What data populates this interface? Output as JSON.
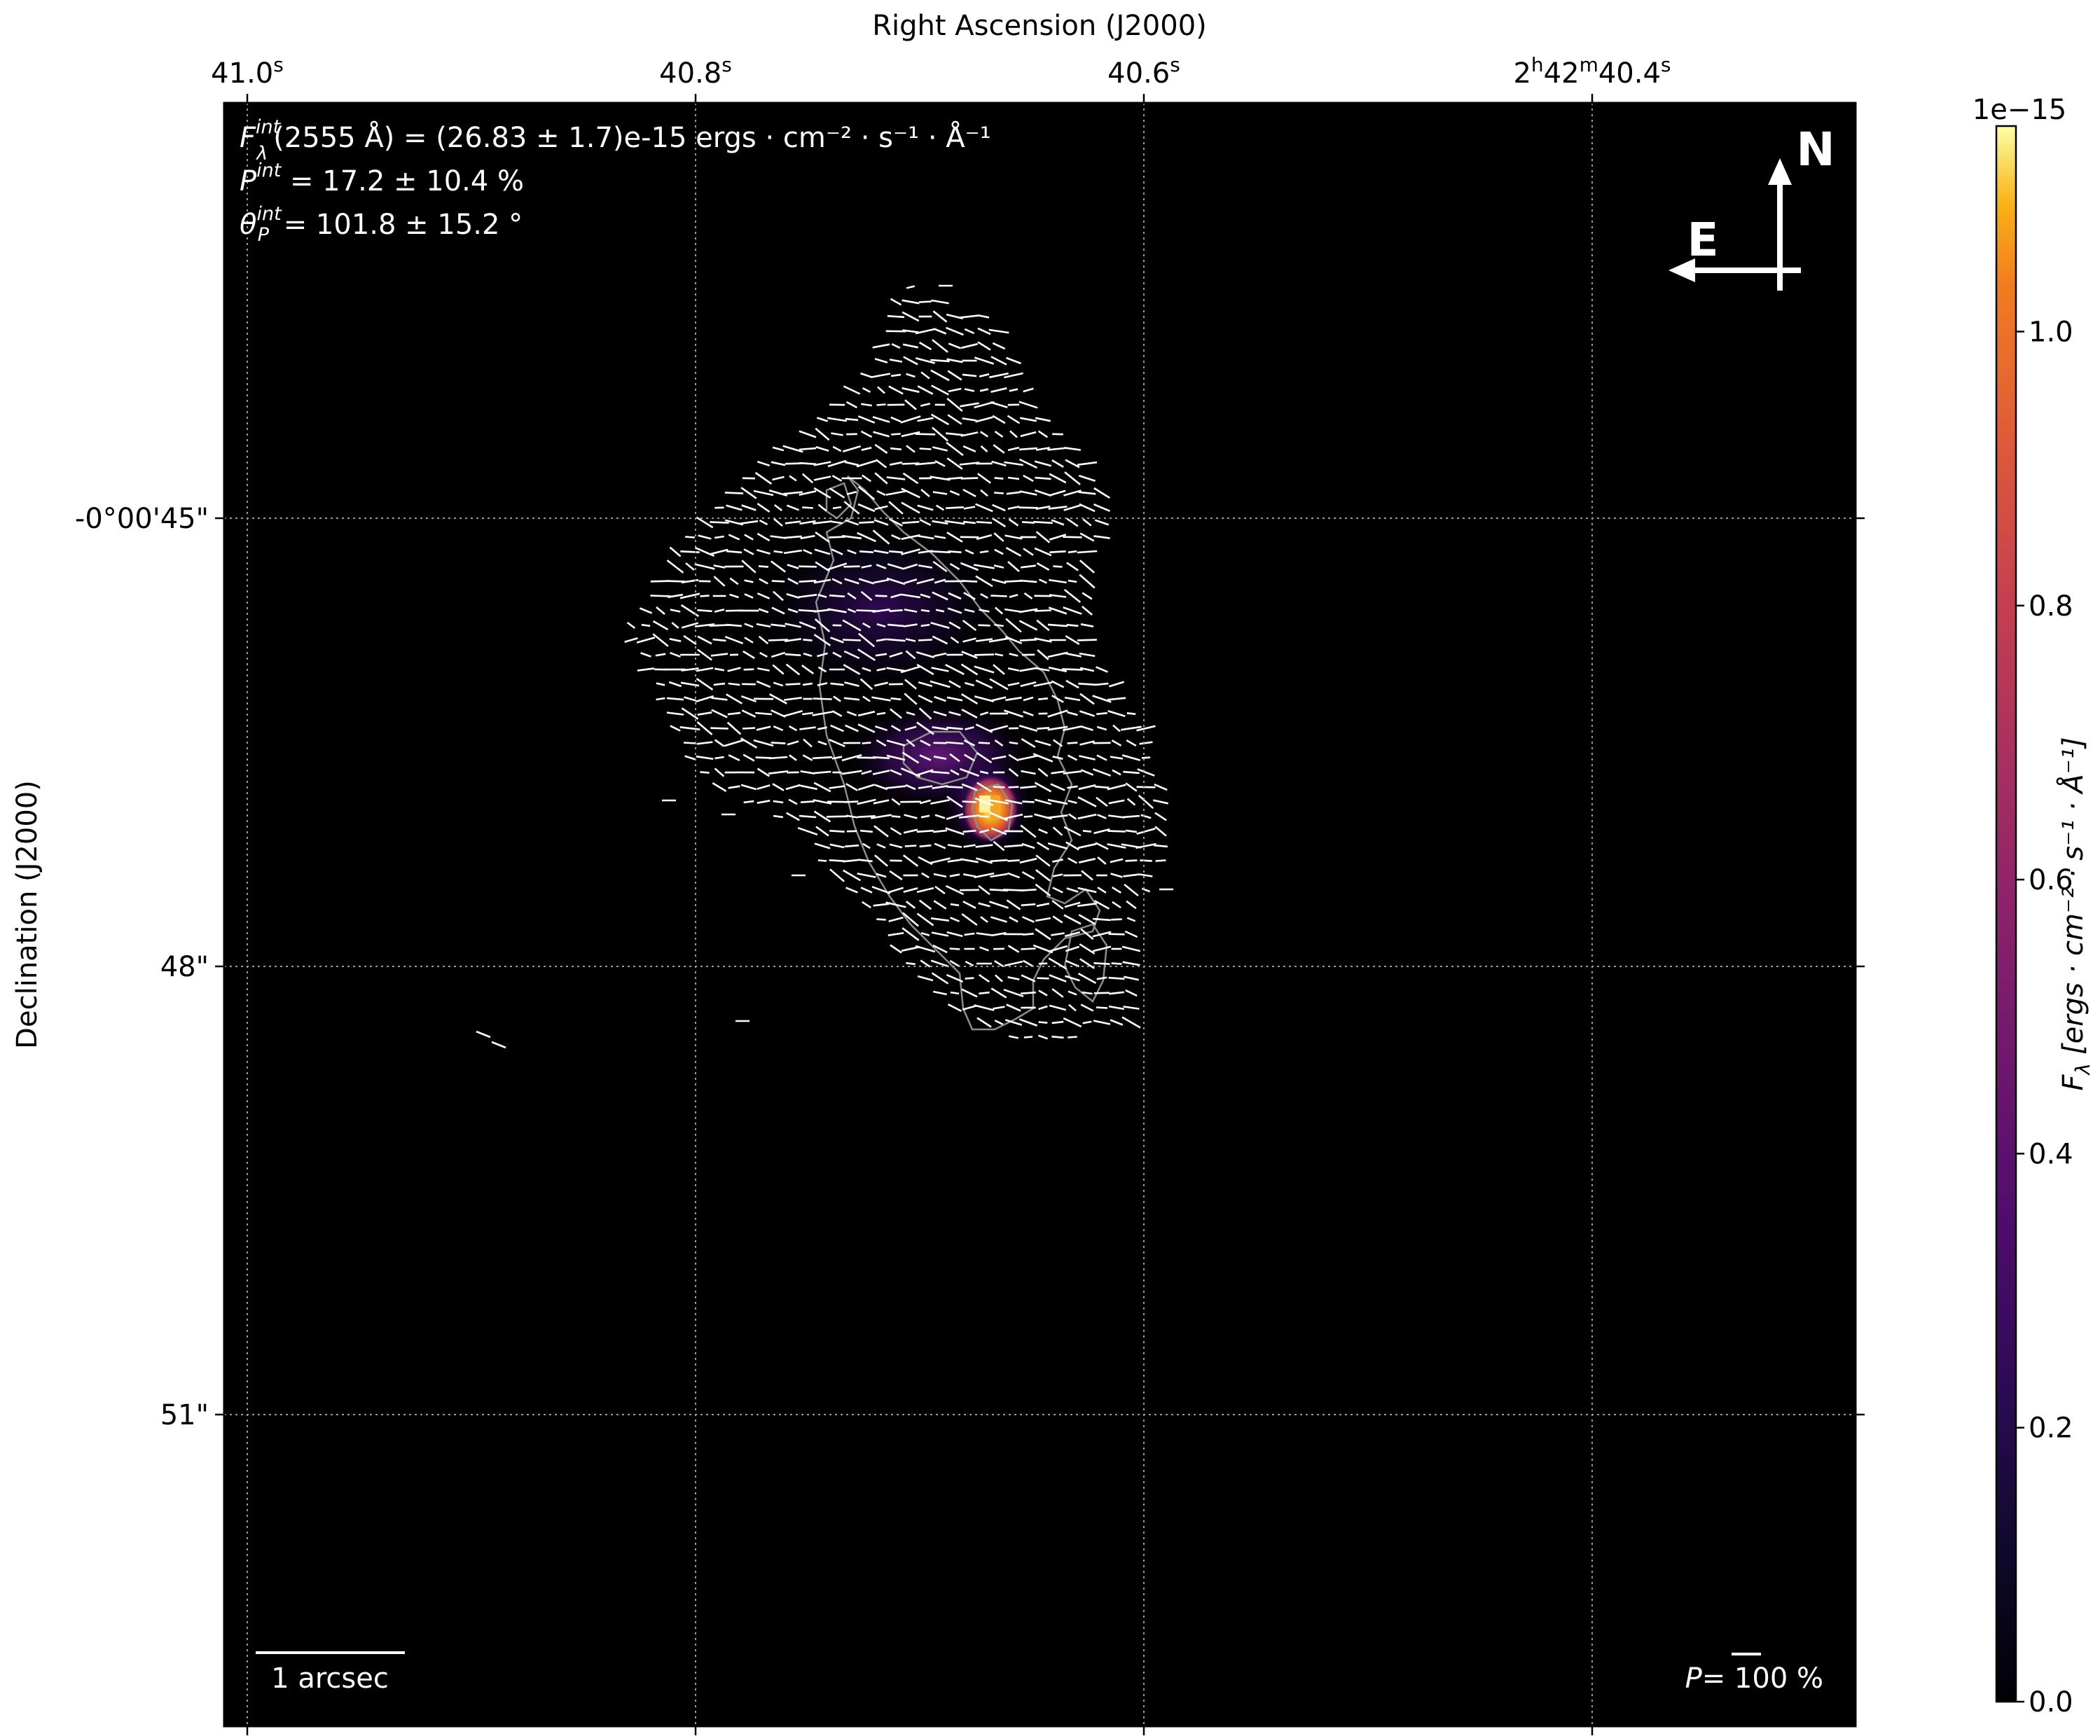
{
  "chart_data": {
    "type": "heatmap",
    "title": "",
    "xlabel": "Right Ascension (J2000)",
    "ylabel": "Declination (J2000)",
    "x_ticks": [
      {
        "main": "41.0",
        "sup": "s"
      },
      {
        "main": "40.8",
        "sup": "s"
      },
      {
        "main": "40.6",
        "sup": "s"
      },
      {
        "main": "2",
        "sup": "h",
        "main2": "42",
        "sup2": "m",
        "main3": "40.4",
        "sup3": "s"
      }
    ],
    "y_ticks": [
      "-0°00'45\"",
      "48\"",
      "51\""
    ],
    "grid": true,
    "colormap": "inferno",
    "colorbar": {
      "label": "F_λ [ergs · cm⁻² · s⁻¹ · Å⁻¹]",
      "label_main": "F",
      "label_sub": "λ",
      "label_rest": "[ergs · cm⁻² · s⁻¹ · Å⁻¹]",
      "scale_label": "1e−15",
      "ticks": [
        "0.0",
        "0.2",
        "0.4",
        "0.6",
        "0.8",
        "1.0"
      ],
      "range": [
        0.0,
        1.15
      ]
    },
    "integrated": {
      "flux_line": "F_λ^int(2555 Å) = (26.83 ± 1.7)e-15 ergs · cm⁻² · s⁻¹ · Å⁻¹",
      "flux_parts": {
        "sym": "F",
        "sub": "λ",
        "sup": "int",
        "text": "(2555 Å) = (26.83 ± 1.7)e-15 ergs · cm⁻² · s⁻¹ · Å⁻¹"
      },
      "pol_parts": {
        "sym": "P",
        "sup": "int",
        "text": " = 17.2 ± 10.4 %"
      },
      "angle_parts": {
        "sym": "θ",
        "sub": "P",
        "sup": "int",
        "text": " = 101.8 ± 15.2 °"
      },
      "flux_value_e15": 26.83,
      "flux_error_e15": 1.7,
      "P_int_percent": 17.2,
      "P_int_error_percent": 10.4,
      "theta_P_int_deg": 101.8,
      "theta_P_int_error_deg": 15.2
    },
    "compass": {
      "north": "N",
      "east": "E"
    },
    "scalebar_label": "1 arcsec",
    "pol_key_label": "P= 100 %",
    "pol_key_sym": "P",
    "pol_key_text": "= 100 %",
    "colors": {
      "background": "#000000",
      "vectors": "#ffffff",
      "contours": "#8c8c8c",
      "peak": "#f6a020"
    }
  }
}
